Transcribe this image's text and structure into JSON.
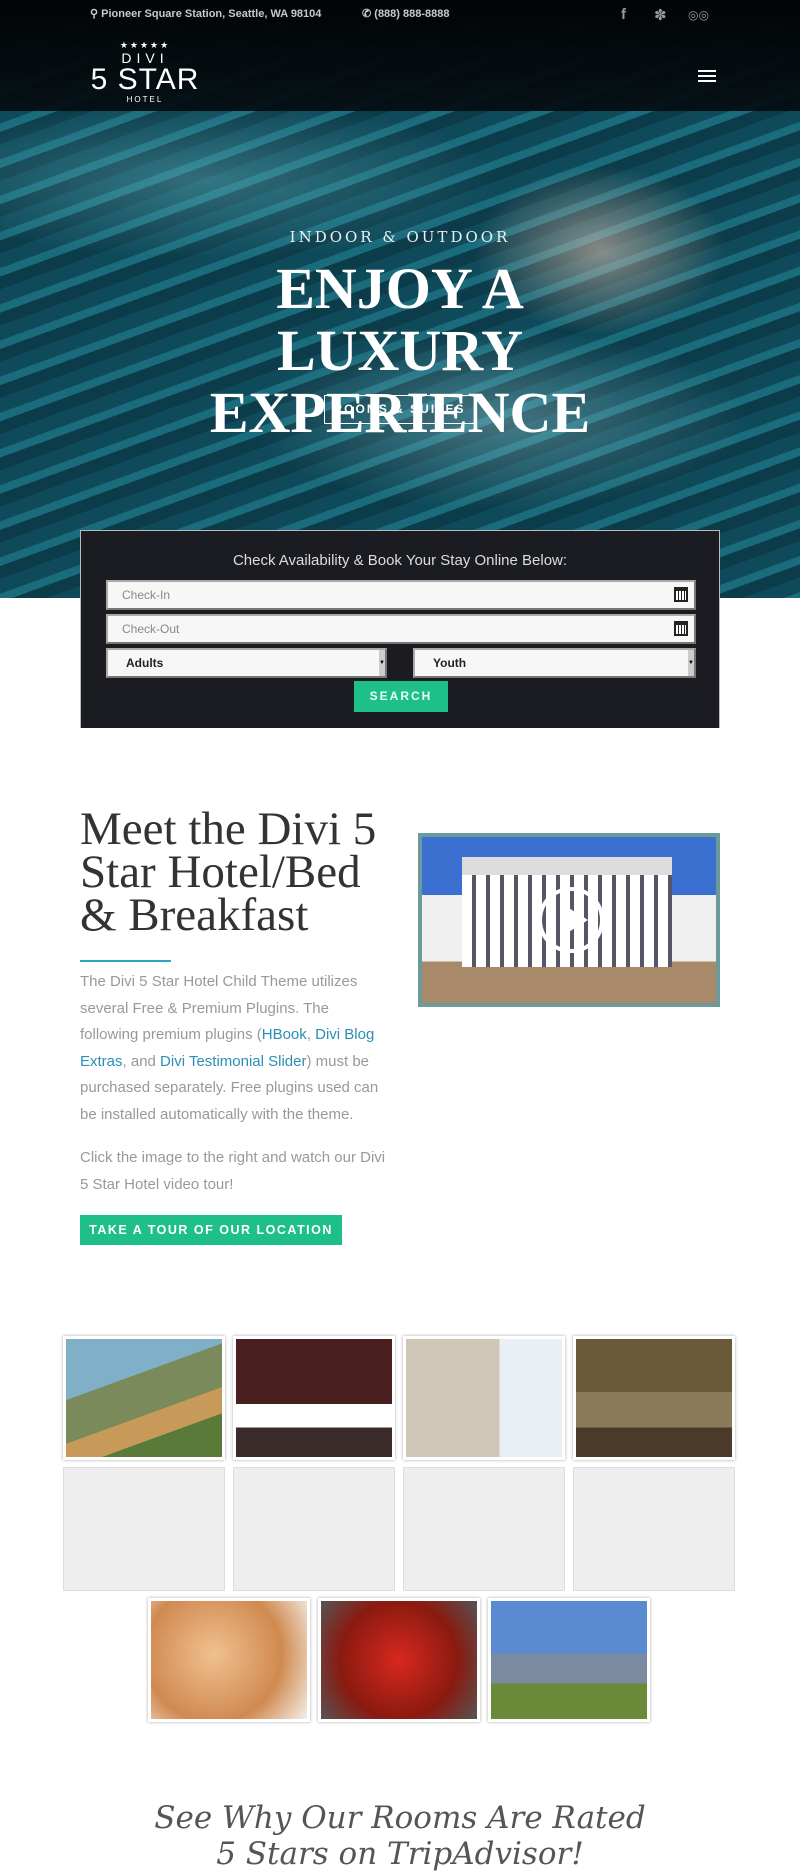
{
  "topbar": {
    "address": "Pioneer Square Station, Seattle, WA 98104",
    "phone": "(888) 888-8888",
    "social": [
      "facebook-icon",
      "yelp-icon",
      "tripadvisor-icon"
    ]
  },
  "logo": {
    "stars": "★★★★★",
    "line1": "DIVI",
    "line2": "5 STAR",
    "line3": "HOTEL"
  },
  "hero": {
    "subtitle": "INDOOR & OUTDOOR",
    "title": "ENJOY A LUXURY EXPERIENCE",
    "button": "ROOMS & SUITES"
  },
  "booking": {
    "title": "Check Availability & Book Your Stay Online Below:",
    "checkin_placeholder": "Check-In",
    "checkout_placeholder": "Check-Out",
    "adults": "Adults",
    "youth": "Youth",
    "search": "SEARCH"
  },
  "about": {
    "heading": "Meet the Divi 5 Star Hotel/Bed & Breakfast",
    "p1_a": "The Divi 5 Star Hotel Child Theme utilizes several Free & Premium Plugins. The following premium plugins (",
    "link1": "HBook",
    "sep1": ", ",
    "link2": "Divi Blog Extras",
    "sep2": ", and ",
    "link3": "Divi Testimonial Slider",
    "p1_b": ") must be purchased separately. Free plugins used can be installed automatically with the theme.",
    "p2": "Click the image to the right and watch our Divi 5 Star Hotel video tour!",
    "button": "TAKE A TOUR OF OUR LOCATION"
  },
  "colors": {
    "accent": "#1fbf8a",
    "link": "#2a8fb5",
    "booking_bg": "#1b1c22"
  },
  "gallery": [
    "coastal village",
    "hotel bedroom",
    "hotel room with balcony",
    "hotel suite",
    "",
    "",
    "",
    "",
    "massage",
    "tomatoes",
    "mountain view"
  ],
  "testimonials": {
    "heading": "See Why Our Rooms Are Rated 5 Stars on TripAdvisor!"
  }
}
